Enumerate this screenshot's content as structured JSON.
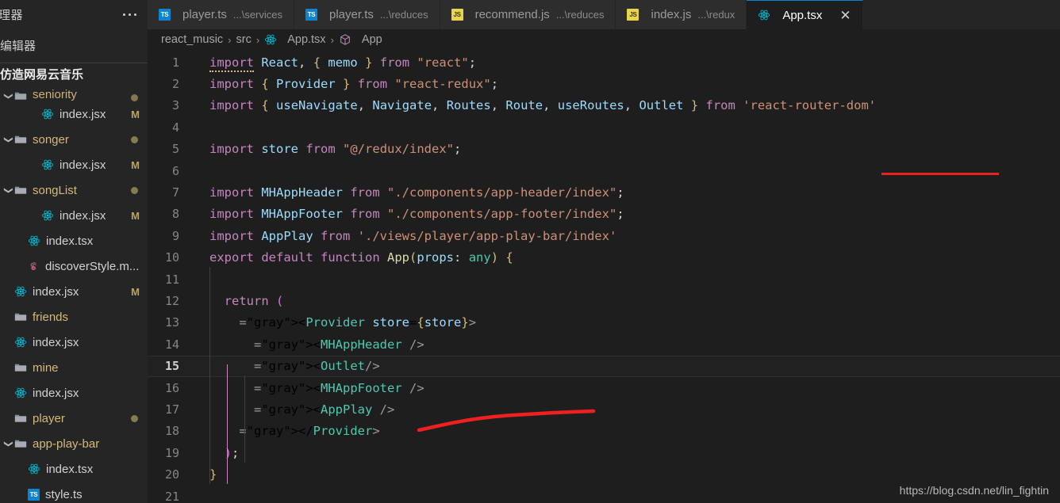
{
  "sidebar": {
    "header_title": "理器",
    "overflow_icon": "ellipsis-icon",
    "open_editors_label": "编辑器",
    "project_title": "仿造网易云音乐",
    "tree": [
      {
        "indent": 0,
        "chevron": "v",
        "icon": "folder-icon",
        "label": "seniority",
        "kind": "folder",
        "badge": "",
        "dot": true,
        "clipped": true
      },
      {
        "indent": 2,
        "chevron": "",
        "icon": "react-icon",
        "label": "index.jsx",
        "kind": "file",
        "badge": "M",
        "dot": false
      },
      {
        "indent": 0,
        "chevron": "v",
        "icon": "folder-icon",
        "label": "songer",
        "kind": "folder",
        "badge": "",
        "dot": true
      },
      {
        "indent": 2,
        "chevron": "",
        "icon": "react-icon",
        "label": "index.jsx",
        "kind": "file",
        "badge": "M",
        "dot": false
      },
      {
        "indent": 0,
        "chevron": "v",
        "icon": "folder-icon",
        "label": "songList",
        "kind": "folder",
        "badge": "",
        "dot": true
      },
      {
        "indent": 2,
        "chevron": "",
        "icon": "react-icon",
        "label": "index.jsx",
        "kind": "file",
        "badge": "M",
        "dot": false
      },
      {
        "indent": 1,
        "chevron": "",
        "icon": "react-icon",
        "label": "index.tsx",
        "kind": "file",
        "badge": "",
        "dot": false
      },
      {
        "indent": 1,
        "chevron": "",
        "icon": "sass-icon",
        "label": "discoverStyle.m...",
        "kind": "file",
        "badge": "",
        "dot": false
      },
      {
        "indent": 0,
        "chevron": "",
        "icon": "react-icon",
        "label": "index.jsx",
        "kind": "file",
        "badge": "M",
        "dot": false
      },
      {
        "indent": 0,
        "chevron": "",
        "icon": "folder-icon",
        "label": "friends",
        "kind": "folder",
        "badge": "",
        "dot": false
      },
      {
        "indent": 0,
        "chevron": "",
        "icon": "react-icon",
        "label": "index.jsx",
        "kind": "file",
        "badge": "",
        "dot": false
      },
      {
        "indent": 0,
        "chevron": "",
        "icon": "folder-icon",
        "label": "mine",
        "kind": "folder",
        "badge": "",
        "dot": false
      },
      {
        "indent": 0,
        "chevron": "",
        "icon": "react-icon",
        "label": "index.jsx",
        "kind": "file",
        "badge": "",
        "dot": false
      },
      {
        "indent": 0,
        "chevron": "",
        "icon": "folder-icon",
        "label": "player",
        "kind": "folder",
        "badge": "",
        "dot": true
      },
      {
        "indent": 0,
        "chevron": "v",
        "icon": "folder-icon",
        "label": "app-play-bar",
        "kind": "folder",
        "badge": "",
        "dot": false
      },
      {
        "indent": 1,
        "chevron": "",
        "icon": "react-icon",
        "label": "index.tsx",
        "kind": "file",
        "badge": "",
        "dot": false
      },
      {
        "indent": 1,
        "chevron": "",
        "icon": "ts-icon",
        "label": "style.ts",
        "kind": "file",
        "badge": "",
        "dot": false
      }
    ]
  },
  "tabs": [
    {
      "icon": "ts-icon",
      "name": "player.ts",
      "path": "...\\services",
      "active": false,
      "closable": false
    },
    {
      "icon": "ts-icon",
      "name": "player.ts",
      "path": "...\\reduces",
      "active": false,
      "closable": false
    },
    {
      "icon": "js-icon",
      "name": "recommend.js",
      "path": "...\\reduces",
      "active": false,
      "closable": false
    },
    {
      "icon": "js-icon",
      "name": "index.js",
      "path": "...\\redux",
      "active": false,
      "closable": false
    },
    {
      "icon": "react-icon",
      "name": "App.tsx",
      "path": "",
      "active": true,
      "closable": true,
      "close_label": "✕"
    }
  ],
  "breadcrumb": [
    {
      "label": "react_music",
      "icon": ""
    },
    {
      "label": "src",
      "icon": ""
    },
    {
      "label": "App.tsx",
      "icon": "react-icon"
    },
    {
      "label": "App",
      "icon": "symbol-cube-icon"
    }
  ],
  "breadcrumb_separator": "›",
  "editor": {
    "language": "tsx",
    "current_line": 15,
    "first_line": 1,
    "last_visible_line": 21,
    "lines": [
      {
        "n": 1,
        "text": "import React, { memo } from \"react\";"
      },
      {
        "n": 2,
        "text": "import { Provider } from \"react-redux\";"
      },
      {
        "n": 3,
        "text": "import { useNavigate, Navigate, Routes, Route, useRoutes, Outlet } from 'react-router-dom'"
      },
      {
        "n": 4,
        "text": ""
      },
      {
        "n": 5,
        "text": "import store from \"@/redux/index\";"
      },
      {
        "n": 6,
        "text": ""
      },
      {
        "n": 7,
        "text": "import MHAppHeader from \"./components/app-header/index\";"
      },
      {
        "n": 8,
        "text": "import MHAppFooter from \"./components/app-footer/index\";"
      },
      {
        "n": 9,
        "text": "import AppPlay from './views/player/app-play-bar/index'"
      },
      {
        "n": 10,
        "text": "export default function App(props: any) {"
      },
      {
        "n": 11,
        "text": ""
      },
      {
        "n": 12,
        "text": "  return ("
      },
      {
        "n": 13,
        "text": "    <Provider store={store}>"
      },
      {
        "n": 14,
        "text": "      <MHAppHeader />"
      },
      {
        "n": 15,
        "text": "      <Outlet/>"
      },
      {
        "n": 16,
        "text": "      <MHAppFooter />"
      },
      {
        "n": 17,
        "text": "      <AppPlay />"
      },
      {
        "n": 18,
        "text": "    </Provider>"
      },
      {
        "n": 19,
        "text": "  );"
      },
      {
        "n": 20,
        "text": "}"
      },
      {
        "n": 21,
        "text": ""
      }
    ]
  },
  "annotations": [
    {
      "name": "red-underline-outlet-import",
      "color": "#f02020",
      "target_line": 3,
      "target_token": "Outlet"
    },
    {
      "name": "red-handdrawn-line-outlet-jsx",
      "color": "#f02020",
      "target_line": 15,
      "target_token": "<Outlet/>"
    }
  ],
  "watermark": "https://blog.csdn.net/lin_fightin",
  "colors": {
    "editor_bg": "#1e1e1e",
    "sidebar_bg": "#252526",
    "tab_inactive_bg": "#2d2d2d",
    "tab_active_bg": "#1e1e1e",
    "accent_blue": "#0b84d1",
    "modified_badge": "#b8a369",
    "annotation_red": "#f02020",
    "react_icon": "#00bcd4",
    "sass_icon": "#cf649a"
  }
}
